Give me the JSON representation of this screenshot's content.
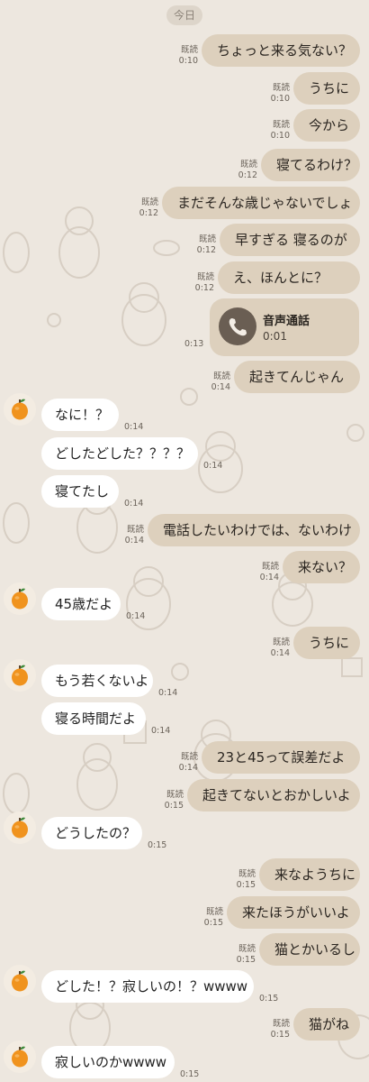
{
  "date_label": "今日",
  "read_label": "既読",
  "call": {
    "title": "音声通話",
    "duration": "0:01",
    "time": "0:13"
  },
  "messages": [
    {
      "side": "out",
      "text": "ちょっと来る気ない？",
      "time": "0:10"
    },
    {
      "side": "out",
      "text": "うちに",
      "time": "0:10"
    },
    {
      "side": "out",
      "text": "今から",
      "time": "0:10"
    },
    {
      "side": "out",
      "text": "寝てるわけ？",
      "time": "0:12"
    },
    {
      "side": "out",
      "text": "まだそんな歳じゃないでしょ",
      "time": "0:12"
    },
    {
      "side": "out",
      "text": "早すぎる  寝るのが",
      "time": "0:12"
    },
    {
      "side": "out",
      "text": "え、ほんとに？",
      "time": "0:12"
    },
    {
      "side": "out",
      "text": "起きてんじゃん",
      "time": "0:14"
    },
    {
      "side": "in",
      "text": "なに！？",
      "time": "0:14",
      "avatar": true
    },
    {
      "side": "in",
      "text": "どしたどした？？？？",
      "time": "0:14"
    },
    {
      "side": "in",
      "text": "寝てたし",
      "time": "0:14"
    },
    {
      "side": "out",
      "text": "電話したいわけでは、ないわけ",
      "time": "0:14"
    },
    {
      "side": "out",
      "text": "来ない？",
      "time": "0:14"
    },
    {
      "side": "in",
      "text": "45歳だよ",
      "time": "0:14",
      "avatar": true
    },
    {
      "side": "out",
      "text": "うちに",
      "time": "0:14"
    },
    {
      "side": "in",
      "text": "もう若くないよ",
      "time": "0:14",
      "avatar": true
    },
    {
      "side": "in",
      "text": "寝る時間だよ",
      "time": "0:14"
    },
    {
      "side": "out",
      "text": "23と45って誤差だよ",
      "time": "0:14"
    },
    {
      "side": "out",
      "text": "起きてないとおかしいよ",
      "time": "0:15"
    },
    {
      "side": "in",
      "text": "どうしたの？",
      "time": "0:15",
      "avatar": true
    },
    {
      "side": "out",
      "text": "来なようちに",
      "time": "0:15"
    },
    {
      "side": "out",
      "text": "来たほうがいいよ",
      "time": "0:15"
    },
    {
      "side": "out",
      "text": "猫とかいるし",
      "time": "0:15"
    },
    {
      "side": "in",
      "text": "どした！？寂しいの！？wwww",
      "time": "0:15",
      "avatar": true
    },
    {
      "side": "out",
      "text": "猫がね",
      "time": "0:15"
    },
    {
      "side": "in",
      "text": "寂しいのかwwww",
      "time": "0:15",
      "avatar": true
    }
  ],
  "colors": {
    "background": "#ede7df",
    "outgoing_bubble": "#ddd0bd",
    "incoming_bubble": "#ffffff",
    "avatar_icon": "#f0931e",
    "call_icon_bg": "#6a5e53"
  },
  "icons": {
    "avatar": "orange-fruit-icon",
    "call": "phone-handset-icon"
  }
}
